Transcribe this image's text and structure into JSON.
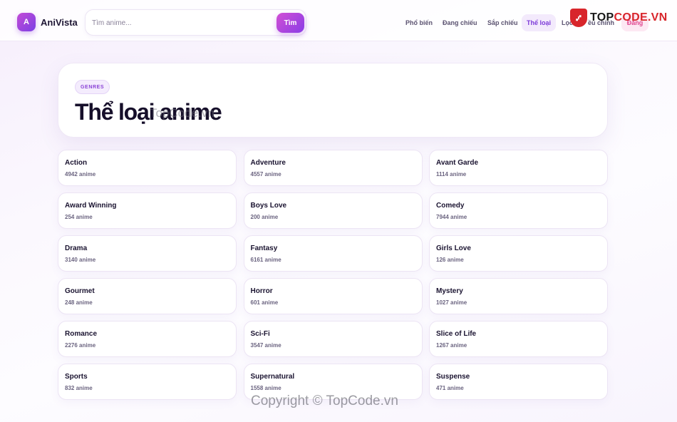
{
  "header": {
    "logo_letter": "A",
    "brand": "AniVista",
    "search": {
      "placeholder": "Tìm anime...",
      "value": "",
      "button_label": "Tìm"
    },
    "nav": [
      {
        "label": "Phổ biến",
        "active": false
      },
      {
        "label": "Đang chiếu",
        "active": false
      },
      {
        "label": "Sắp chiếu",
        "active": false
      },
      {
        "label": "Thể loại",
        "active": true
      },
      {
        "label": "Lọc",
        "active": false
      }
    ],
    "nav_partial": "ều chỉnh",
    "login_label": "Đăng"
  },
  "watermark": {
    "shield_glyph": "⑇",
    "logo_text_prefix": "TOP",
    "logo_text_suffix": "CODE.VN",
    "hero_overlay": "TopCode.vn",
    "copyright": "Copyright © TopCode.vn"
  },
  "hero": {
    "chip": "GENRES",
    "title": "Thể loại anime"
  },
  "genres": [
    {
      "name": "Action",
      "count": "4942 anime"
    },
    {
      "name": "Adventure",
      "count": "4557 anime"
    },
    {
      "name": "Avant Garde",
      "count": "1114 anime"
    },
    {
      "name": "Award Winning",
      "count": "254 anime"
    },
    {
      "name": "Boys Love",
      "count": "200 anime"
    },
    {
      "name": "Comedy",
      "count": "7944 anime"
    },
    {
      "name": "Drama",
      "count": "3140 anime"
    },
    {
      "name": "Fantasy",
      "count": "6161 anime"
    },
    {
      "name": "Girls Love",
      "count": "126 anime"
    },
    {
      "name": "Gourmet",
      "count": "248 anime"
    },
    {
      "name": "Horror",
      "count": "601 anime"
    },
    {
      "name": "Mystery",
      "count": "1027 anime"
    },
    {
      "name": "Romance",
      "count": "2276 anime"
    },
    {
      "name": "Sci-Fi",
      "count": "3547 anime"
    },
    {
      "name": "Slice of Life",
      "count": "1267 anime"
    },
    {
      "name": "Sports",
      "count": "832 anime"
    },
    {
      "name": "Supernatural",
      "count": "1558 anime"
    },
    {
      "name": "Suspense",
      "count": "471 anime"
    }
  ],
  "colors": {
    "accent": "#8a3de6",
    "accent_pink": "#d24fd4",
    "active_nav_bg": "#f3eafc",
    "watermark_red": "#d8252b"
  }
}
